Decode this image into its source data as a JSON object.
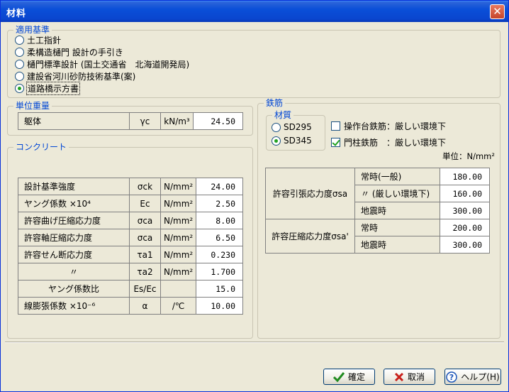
{
  "window": {
    "title": "材料",
    "close_glyph": "✕"
  },
  "standard": {
    "legend": "適用基準",
    "options": [
      {
        "label": "土工指針",
        "selected": false
      },
      {
        "label": "柔構造樋門 設計の手引き",
        "selected": false
      },
      {
        "label": "樋門標準設計 (国土交通省　北海道開発局)",
        "selected": false
      },
      {
        "label": "建設省河川砂防技術基準(案)",
        "selected": false
      },
      {
        "label": "道路橋示方書",
        "selected": true
      }
    ]
  },
  "unit_weight": {
    "legend": "単位重量",
    "row": {
      "name": "躯体",
      "symbol": "γc",
      "unit": "kN/m³",
      "value": "24.50"
    }
  },
  "concrete": {
    "legend": "コンクリート",
    "rows": [
      {
        "name": "設計基準強度",
        "symbol": "σck",
        "unit": "N/mm²",
        "value": "24.00"
      },
      {
        "name": "ヤング係数 ×10⁴",
        "symbol": "Ec",
        "unit": "N/mm²",
        "value": "2.50"
      },
      {
        "name": "許容曲げ圧縮応力度",
        "symbol": "σca",
        "unit": "N/mm²",
        "value": "8.00"
      },
      {
        "name": "許容軸圧縮応力度",
        "symbol": "σca",
        "unit": "N/mm²",
        "value": "6.50"
      },
      {
        "name": "許容せん断応力度",
        "symbol": "τa1",
        "unit": "N/mm²",
        "value": "0.230"
      },
      {
        "name": "〃",
        "symbol": "τa2",
        "unit": "N/mm²",
        "value": "1.700"
      },
      {
        "name": "ヤング係数比",
        "symbol": "Es/Ec",
        "unit": "",
        "value": "15.0"
      },
      {
        "name": "線膨張係数 ×10⁻⁶",
        "symbol": "α",
        "unit": "/℃",
        "value": "10.00"
      }
    ]
  },
  "rebar": {
    "legend": "鉄筋",
    "material": {
      "legend": "材質",
      "options": [
        {
          "label": "SD295",
          "selected": false
        },
        {
          "label": "SD345",
          "selected": true
        }
      ]
    },
    "checks": [
      {
        "label": "操作台鉄筋：厳しい環境下",
        "checked": false
      },
      {
        "label": "門柱鉄筋　：厳しい環境下",
        "checked": true
      }
    ],
    "unit_label": "単位：N/mm²",
    "tension": {
      "label": "許容引張応力度σsa",
      "rows": [
        {
          "case": "常時(一般)",
          "value": "180.00"
        },
        {
          "case": "〃 (厳しい環境下)",
          "value": "160.00"
        },
        {
          "case": "地震時",
          "value": "300.00"
        }
      ]
    },
    "compression": {
      "label": "許容圧縮応力度σsa'",
      "rows": [
        {
          "case": "常時",
          "value": "200.00"
        },
        {
          "case": "地震時",
          "value": "300.00"
        }
      ]
    }
  },
  "buttons": {
    "ok": "確定",
    "cancel": "取消",
    "help": "ヘルプ(H)"
  }
}
